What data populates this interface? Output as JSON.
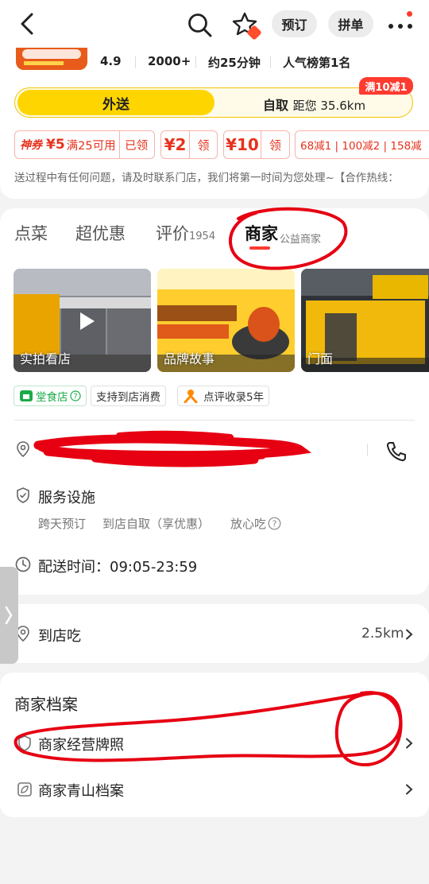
{
  "topbar": {
    "book_label": "预订",
    "group_label": "拼单"
  },
  "stats": {
    "rating": "4.9",
    "sales": "2000+",
    "time": "约25分钟",
    "rank": "人气榜第1名"
  },
  "delivery": {
    "active_label": "外送",
    "pickup_label": "自取",
    "distance": "距您 35.6km",
    "promo_badge": "满10减1"
  },
  "coupons": {
    "shen_label": "神券",
    "c1_amount": "¥5",
    "c1_text": "满25可用",
    "c1_status": "已领",
    "c2_amount": "¥2",
    "c2_action": "领",
    "c3_amount": "¥10",
    "c3_action": "领",
    "c4_text": "68减1 | 100减2 | 158减"
  },
  "notice": "送过程中有任何问题，请及时联系门店，我们将第一时间为您处理~【合作热线：",
  "tabs": {
    "order": "点菜",
    "deals": "超优惠",
    "reviews": "评价",
    "reviews_count": "1954",
    "merchant": "商家",
    "merchant_sub": "公益商家"
  },
  "photos": {
    "p1": "实拍看店",
    "p2": "品牌故事",
    "p3": "门面"
  },
  "tags": {
    "t1": "堂食店",
    "t2": "支持到店消费",
    "t3": "点评收录5年"
  },
  "services": {
    "title": "服务设施",
    "s1": "跨天预订",
    "s2": "到店自取（享优惠）",
    "s3": "放心吃"
  },
  "hours": {
    "label": "配送时间：",
    "value": "09:05-23:59"
  },
  "dine_in": {
    "label": "到店吃",
    "distance": "2.5km"
  },
  "archive": {
    "title": "商家档案",
    "license": "商家经营牌照",
    "green": "商家青山档案"
  },
  "colors": {
    "brand_yellow": "#ffd500",
    "coupon_red": "#e6321d",
    "accent_red": "#ff3b30",
    "green": "#1aab47",
    "orange": "#ff8a00"
  }
}
